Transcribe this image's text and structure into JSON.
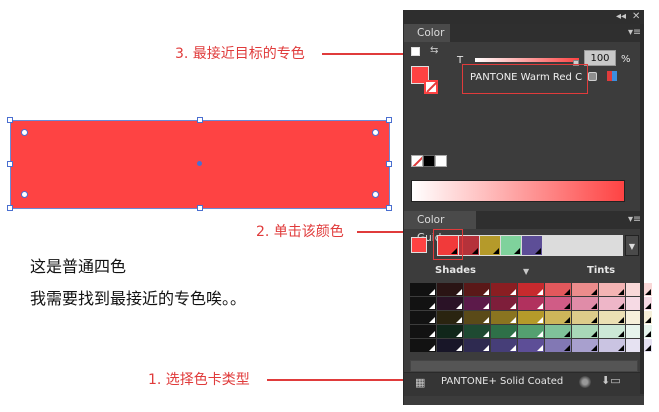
{
  "panel": {
    "color_tab": "Color",
    "tint_label": "T",
    "tint_value": "100",
    "tint_unit": "%",
    "swatch_name": "PANTONE Warm Red C",
    "color_guide_tab": "Color Guide",
    "shades_label": "Shades",
    "tints_label": "Tints",
    "library_name": "PANTONE+ Solid Coated",
    "fill_color": "#fe4343"
  },
  "annotations": {
    "step3": "3. 最接近目标的专色",
    "step2": "2. 单击该颜色",
    "step1": "1. 选择色卡类型"
  },
  "notes": {
    "line1": "这是普通四色",
    "line2": "我需要找到最接近的专色唉。。"
  },
  "guide_colors": {
    "harmony": [
      "#f13a3a",
      "#b5323a",
      "#b59a2a",
      "#7fd29c",
      "#5d4e97"
    ],
    "grid": [
      [
        "#111111",
        "#2a1414",
        "#5a1818",
        "#8a1e22",
        "#c72a2e",
        "#e2585c",
        "#ec8c8c",
        "#f4b4b4",
        "#f9d8d8"
      ],
      [
        "#121212",
        "#2a1226",
        "#5c1a4a",
        "#7e1e3a",
        "#b1315e",
        "#d05c86",
        "#e08ca8",
        "#eeb6c8",
        "#f6dae4"
      ],
      [
        "#121212",
        "#2a2410",
        "#5a4a18",
        "#8a7420",
        "#b59a2a",
        "#cdb65a",
        "#ddcc8a",
        "#ece0b4",
        "#f6f0da"
      ],
      [
        "#121212",
        "#10261a",
        "#1e4a32",
        "#2e7048",
        "#54a070",
        "#7fc29a",
        "#a8d8b8",
        "#cce8d6",
        "#e6f4ec"
      ],
      [
        "#121212",
        "#181628",
        "#2e2a50",
        "#463e78",
        "#5d4e97",
        "#8278b4",
        "#a8a0ce",
        "#cac4e2",
        "#e6e2f2"
      ]
    ]
  }
}
